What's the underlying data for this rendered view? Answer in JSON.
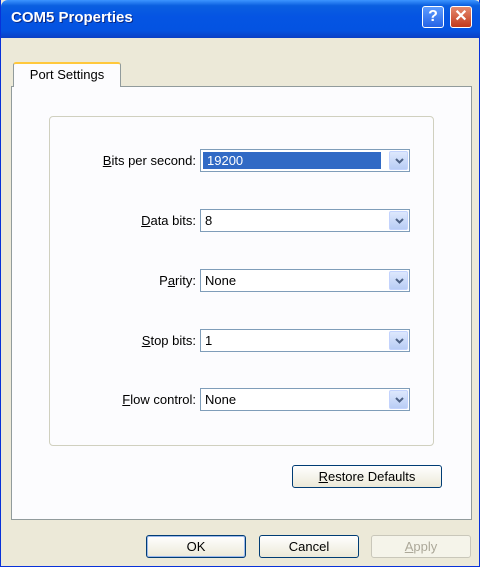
{
  "window": {
    "title": "COM5 Properties",
    "help_glyph": "?",
    "close_glyph": "✕"
  },
  "tabs": [
    {
      "label": "Port Settings",
      "active": true
    }
  ],
  "fields": {
    "bits_per_second": {
      "label_mnemonic": "B",
      "label_rest": "its per second:",
      "value": "19200"
    },
    "data_bits": {
      "label_mnemonic": "D",
      "label_rest": "ata bits:",
      "value": "8"
    },
    "parity": {
      "label_pre": "P",
      "label_mnemonic": "a",
      "label_rest": "rity:",
      "value": "None"
    },
    "stop_bits": {
      "label_mnemonic": "S",
      "label_rest": "top bits:",
      "value": "1"
    },
    "flow_control": {
      "label_mnemonic": "F",
      "label_rest": "low control:",
      "value": "None"
    }
  },
  "buttons": {
    "restore_mnemonic": "R",
    "restore_rest": "estore Defaults",
    "ok": "OK",
    "cancel": "Cancel",
    "apply_mnemonic": "A",
    "apply_rest": "pply"
  },
  "colors": {
    "title_bar": "#0554e3",
    "selection": "#316ac5",
    "dialog_bg": "#ece9d8"
  }
}
